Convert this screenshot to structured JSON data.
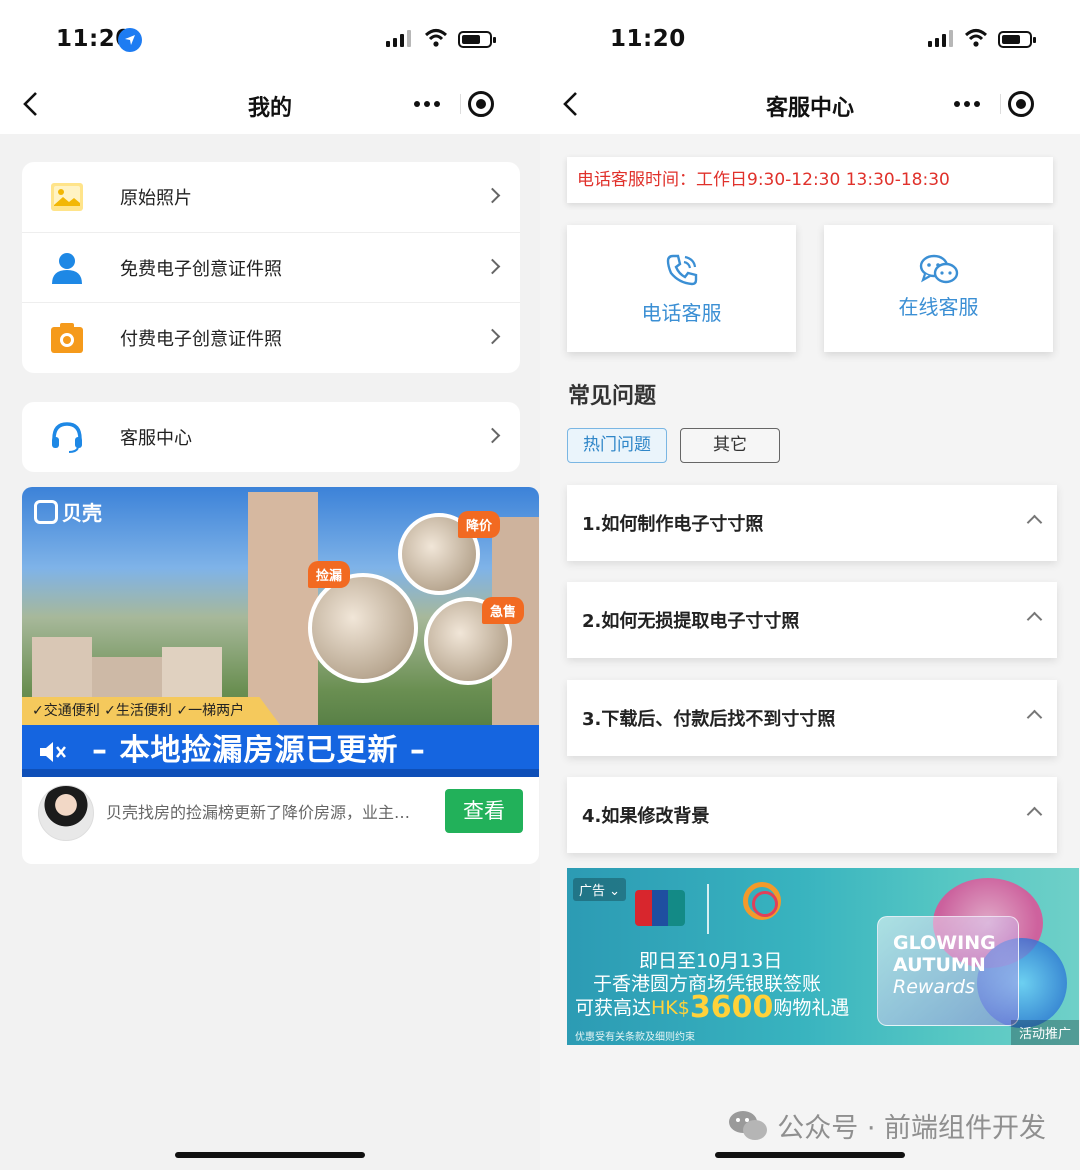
{
  "left": {
    "status": {
      "time": "11:20"
    },
    "nav": {
      "title": "我的"
    },
    "menu_group1": [
      {
        "label": "原始照片",
        "icon": "image-icon"
      },
      {
        "label": "免费电子创意证件照",
        "icon": "person-icon"
      },
      {
        "label": "付费电子创意证件照",
        "icon": "camera-icon"
      }
    ],
    "menu_group2": [
      {
        "label": "客服中心",
        "icon": "headset-icon"
      }
    ],
    "ad": {
      "brand": "贝壳",
      "tags": [
        "降价",
        "捡漏",
        "急售"
      ],
      "features": "✓交通便利 ✓生活便利 ✓一梯两户",
      "headline": "– 本地捡漏房源已更新 –",
      "text": "贝壳找房的捡漏榜更新了降价房源，业主…",
      "button": "查看"
    }
  },
  "right": {
    "status": {
      "time": "11:20"
    },
    "nav": {
      "title": "客服中心"
    },
    "notice": "电话客服时间：工作日9:30-12:30 13:30-18:30",
    "services": [
      {
        "label": "电话客服",
        "icon": "phone-icon"
      },
      {
        "label": "在线客服",
        "icon": "chat-icon"
      }
    ],
    "faq_title": "常见问题",
    "chips": [
      {
        "label": "热门问题",
        "active": true
      },
      {
        "label": "其它",
        "active": false
      }
    ],
    "faqs": [
      "1.如何制作电子寸寸照",
      "2.如何无损提取电子寸寸照",
      "3.下载后、付款后找不到寸寸照",
      "4.如果修改背景"
    ],
    "promo": {
      "badge": "广告",
      "line1": "即日至10月13日",
      "line2": "于香港圆方商场凭银联签账",
      "line3_prefix": "可获高达",
      "line3_currency": "HK$",
      "line3_amount": "3600",
      "line3_suffix": "购物礼遇",
      "fine": "优惠受有关条款及细则约束",
      "campaign_l1": "GLOWING",
      "campaign_l2": "AUTUMN",
      "campaign_l3": "Rewards",
      "label": "活动推广"
    }
  },
  "watermark": "公众号 · 前端组件开发",
  "colors": {
    "accent_blue": "#3b8fd4",
    "notice_red": "#e0312b",
    "ad_green": "#22b15a",
    "headline_blue": "#1565e0"
  }
}
